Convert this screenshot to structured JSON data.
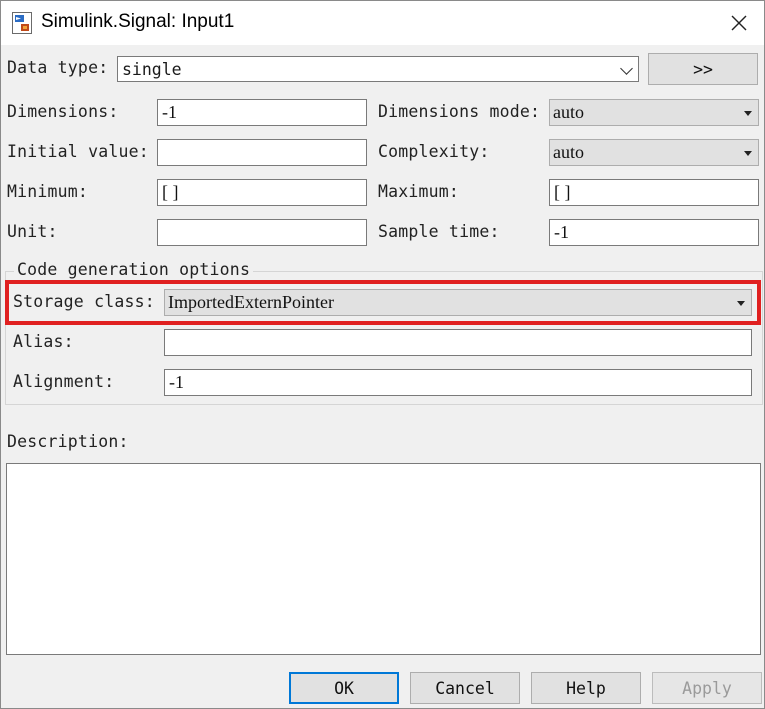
{
  "window": {
    "title": "Simulink.Signal: Input1"
  },
  "icons": {
    "app": "simulink-app-icon",
    "close": "close-icon"
  },
  "form": {
    "data_type": {
      "label": "Data type:",
      "value": "single",
      "more_button": ">>"
    },
    "dimensions": {
      "label": "Dimensions:",
      "value": "-1"
    },
    "dimensions_mode": {
      "label": "Dimensions mode:",
      "value": "auto"
    },
    "initial_value": {
      "label": "Initial value:",
      "value": ""
    },
    "complexity": {
      "label": "Complexity:",
      "value": "auto"
    },
    "minimum": {
      "label": "Minimum:",
      "value": "[ ]"
    },
    "maximum": {
      "label": "Maximum:",
      "value": "[ ]"
    },
    "unit": {
      "label": "Unit:",
      "value": ""
    },
    "sample_time": {
      "label": "Sample time:",
      "value": "-1"
    }
  },
  "code_generation": {
    "group_title": "Code generation options",
    "storage_class": {
      "label": "Storage class:",
      "value": "ImportedExternPointer"
    },
    "alias": {
      "label": "Alias:",
      "value": ""
    },
    "alignment": {
      "label": "Alignment:",
      "value": "-1"
    }
  },
  "description": {
    "label": "Description:",
    "value": ""
  },
  "buttons": {
    "ok": "OK",
    "cancel": "Cancel",
    "help": "Help",
    "apply": "Apply"
  },
  "colors": {
    "highlight": "#e02020",
    "default_button_border": "#0078d7"
  }
}
